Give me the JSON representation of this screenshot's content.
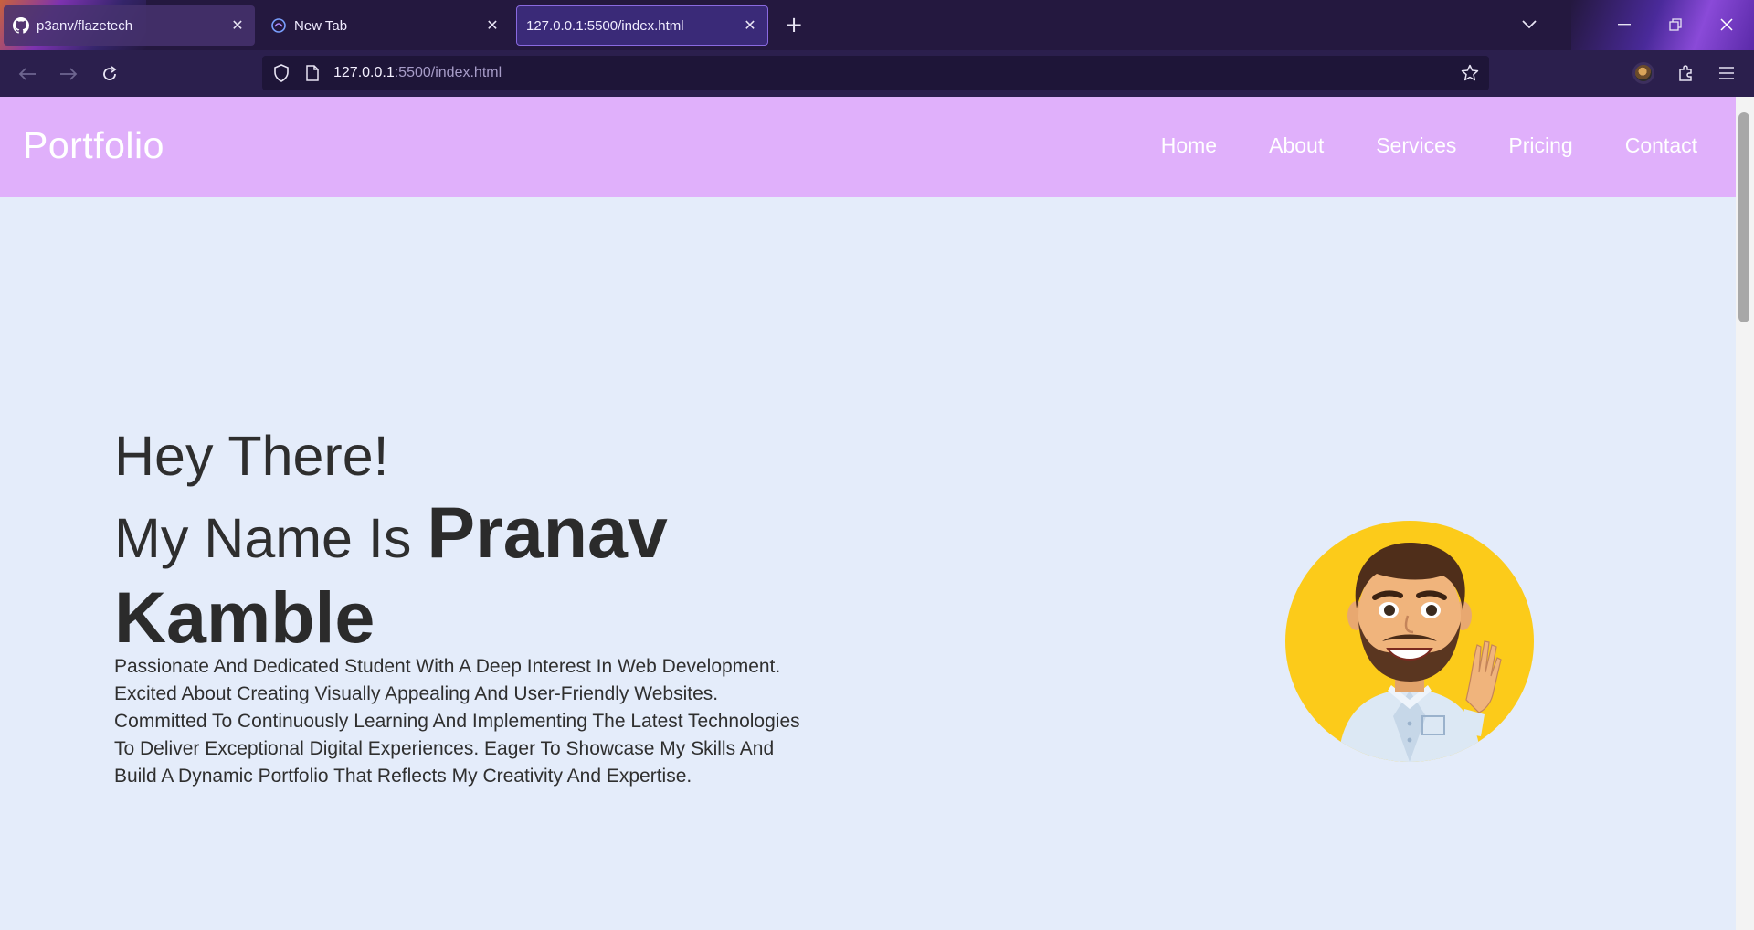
{
  "browser": {
    "tabs": [
      {
        "label": "p3anv/flazetech",
        "icon": "github-icon"
      },
      {
        "label": "New Tab",
        "icon": "firefox-newtab-icon"
      },
      {
        "label": "127.0.0.1:5500/index.html",
        "icon": "none"
      }
    ],
    "active_tab_index": 2,
    "url_host": "127.0.0.1",
    "url_rest": ":5500/index.html",
    "colors": {
      "tabbar": "#24183f",
      "navbar": "#2b1f4d",
      "urlbar": "#1e1538"
    }
  },
  "site": {
    "logo": "Portfolio",
    "nav": [
      "Home",
      "About",
      "Services",
      "Pricing",
      "Contact"
    ],
    "colors": {
      "header": "#e0b0fb",
      "background": "#e4ecfa",
      "avatar_bg": "#fccb1a"
    }
  },
  "hero": {
    "greeting": "Hey There!",
    "name_prefix": "My Name Is",
    "first_name": "Pranav",
    "last_name": "Kamble",
    "bio": "Passionate And Dedicated Student With A Deep Interest In Web Development. Excited About Creating Visually Appealing And User-Friendly Websites. Committed To Continuously Learning And Implementing The Latest Technologies To Deliver Exceptional Digital Experiences. Eager To Showcase My Skills And Build A Dynamic Portfolio That Reflects My Creativity And Expertise."
  }
}
